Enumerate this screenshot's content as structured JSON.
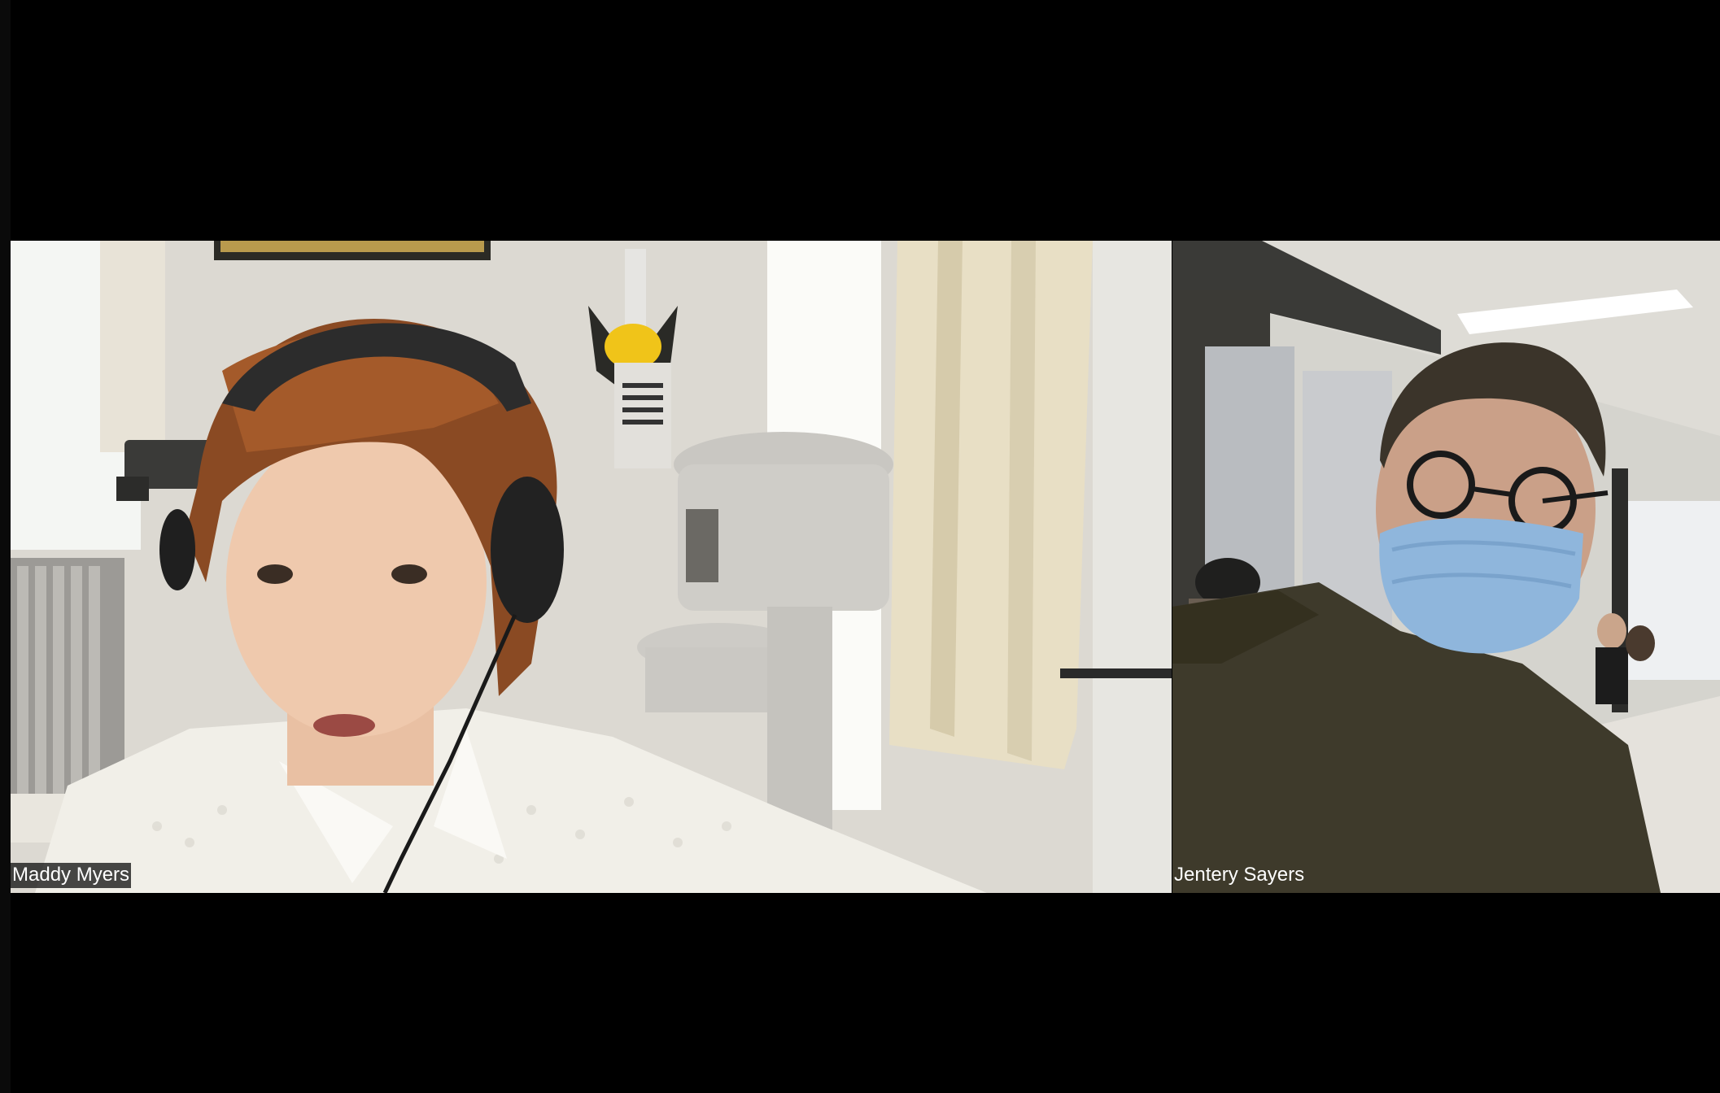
{
  "meeting": {
    "participants": [
      {
        "name": "Maddy Myers"
      },
      {
        "name": "Jentery Sayers"
      }
    ]
  }
}
